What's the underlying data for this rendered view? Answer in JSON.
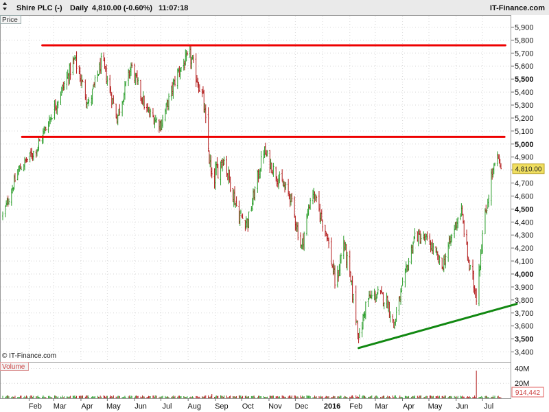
{
  "header": {
    "symbol": "Shire PLC (-)",
    "period": "Daily",
    "quote": "4,810.00 (-0.60%)",
    "time": "11:07:18",
    "brand": "IT-Finance.com"
  },
  "price_panel": {
    "label": "Price",
    "watermark": "© IT-Finance.com",
    "last_price_tag": "4,810.00"
  },
  "volume_panel": {
    "label": "Volume",
    "last_volume_tag": "914,442"
  },
  "colors": {
    "up": "#2a9d2a",
    "down": "#b21a1a",
    "resistance": "#ee0000",
    "support": "#118811",
    "grid": "#d6d6d6"
  },
  "chart_data": [
    {
      "type": "candlestick",
      "title": "Shire PLC (-) Daily",
      "ylabel": "Price",
      "ylim": [
        3350,
        5950
      ],
      "y_ticks": [
        {
          "value": 3400,
          "label": "3,400",
          "bold": false
        },
        {
          "value": 3500,
          "label": "3,500",
          "bold": true
        },
        {
          "value": 3600,
          "label": "3,600",
          "bold": false
        },
        {
          "value": 3700,
          "label": "3,700",
          "bold": false
        },
        {
          "value": 3800,
          "label": "3,800",
          "bold": false
        },
        {
          "value": 3900,
          "label": "3,900",
          "bold": false
        },
        {
          "value": 4000,
          "label": "4,000",
          "bold": true
        },
        {
          "value": 4100,
          "label": "4,100",
          "bold": false
        },
        {
          "value": 4200,
          "label": "4,200",
          "bold": false
        },
        {
          "value": 4300,
          "label": "4,300",
          "bold": false
        },
        {
          "value": 4400,
          "label": "4,400",
          "bold": false
        },
        {
          "value": 4500,
          "label": "4,500",
          "bold": true
        },
        {
          "value": 4600,
          "label": "4,600",
          "bold": false
        },
        {
          "value": 4700,
          "label": "4,700",
          "bold": false
        },
        {
          "value": 4800,
          "label": "4,800",
          "bold": false
        },
        {
          "value": 4900,
          "label": "4,900",
          "bold": false
        },
        {
          "value": 5000,
          "label": "5,000",
          "bold": true
        },
        {
          "value": 5100,
          "label": "5,100",
          "bold": false
        },
        {
          "value": 5200,
          "label": "5,200",
          "bold": false
        },
        {
          "value": 5300,
          "label": "5,300",
          "bold": false
        },
        {
          "value": 5400,
          "label": "5,400",
          "bold": false
        },
        {
          "value": 5500,
          "label": "5,500",
          "bold": true
        },
        {
          "value": 5600,
          "label": "5,600",
          "bold": false
        },
        {
          "value": 5700,
          "label": "5,700",
          "bold": false
        },
        {
          "value": 5800,
          "label": "5,800",
          "bold": false
        },
        {
          "value": 5900,
          "label": "5,900",
          "bold": false
        }
      ],
      "x_axis": {
        "start": "2015-01-02",
        "end": "2016-07-22",
        "labels": [
          {
            "label": "Feb",
            "date": "2015-02-01",
            "bold": false
          },
          {
            "label": "Mar",
            "date": "2015-03-01",
            "bold": false
          },
          {
            "label": "Apr",
            "date": "2015-04-01",
            "bold": false
          },
          {
            "label": "May",
            "date": "2015-05-01",
            "bold": false
          },
          {
            "label": "Jun",
            "date": "2015-06-01",
            "bold": false
          },
          {
            "label": "Jul",
            "date": "2015-07-01",
            "bold": false
          },
          {
            "label": "Aug",
            "date": "2015-08-01",
            "bold": false
          },
          {
            "label": "Sep",
            "date": "2015-09-01",
            "bold": false
          },
          {
            "label": "Oct",
            "date": "2015-10-01",
            "bold": false
          },
          {
            "label": "Nov",
            "date": "2015-11-01",
            "bold": false
          },
          {
            "label": "Dec",
            "date": "2015-12-01",
            "bold": false
          },
          {
            "label": "2016",
            "date": "2016-01-01",
            "bold": true
          },
          {
            "label": "Feb",
            "date": "2016-02-01",
            "bold": false
          },
          {
            "label": "Mar",
            "date": "2016-03-01",
            "bold": false
          },
          {
            "label": "Apr",
            "date": "2016-04-01",
            "bold": false
          },
          {
            "label": "May",
            "date": "2016-05-01",
            "bold": false
          },
          {
            "label": "Jun",
            "date": "2016-06-01",
            "bold": false
          },
          {
            "label": "Jul",
            "date": "2016-07-01",
            "bold": false
          }
        ]
      },
      "anchors": [
        {
          "date": "2015-01-02",
          "close": 4450,
          "range": 90
        },
        {
          "date": "2015-01-20",
          "close": 4800,
          "range": 100
        },
        {
          "date": "2015-02-10",
          "close": 4970,
          "range": 110
        },
        {
          "date": "2015-02-28",
          "close": 5250,
          "range": 120
        },
        {
          "date": "2015-03-25",
          "close": 5650,
          "range": 130
        },
        {
          "date": "2015-04-10",
          "close": 5300,
          "range": 130
        },
        {
          "date": "2015-04-25",
          "close": 5650,
          "range": 120
        },
        {
          "date": "2015-05-12",
          "close": 5200,
          "range": 120
        },
        {
          "date": "2015-05-28",
          "close": 5600,
          "range": 120
        },
        {
          "date": "2015-06-15",
          "close": 5250,
          "range": 120
        },
        {
          "date": "2015-07-01",
          "close": 5150,
          "range": 110
        },
        {
          "date": "2015-07-20",
          "close": 5550,
          "range": 120
        },
        {
          "date": "2015-08-03",
          "close": 5680,
          "range": 140
        },
        {
          "date": "2015-08-18",
          "close": 5350,
          "range": 150
        },
        {
          "date": "2015-08-28",
          "close": 4700,
          "range": 200
        },
        {
          "date": "2015-09-10",
          "close": 4900,
          "range": 150
        },
        {
          "date": "2015-09-28",
          "close": 4450,
          "range": 150
        },
        {
          "date": "2015-10-08",
          "close": 4400,
          "range": 140
        },
        {
          "date": "2015-10-26",
          "close": 4950,
          "range": 130
        },
        {
          "date": "2015-11-10",
          "close": 4750,
          "range": 120
        },
        {
          "date": "2015-11-25",
          "close": 4600,
          "range": 120
        },
        {
          "date": "2015-12-08",
          "close": 4200,
          "range": 130
        },
        {
          "date": "2015-12-20",
          "close": 4650,
          "range": 120
        },
        {
          "date": "2016-01-06",
          "close": 4300,
          "range": 130
        },
        {
          "date": "2016-01-16",
          "close": 3900,
          "range": 150
        },
        {
          "date": "2016-01-25",
          "close": 4250,
          "range": 150
        },
        {
          "date": "2016-02-04",
          "close": 3850,
          "range": 150
        },
        {
          "date": "2016-02-12",
          "close": 3500,
          "range": 150
        },
        {
          "date": "2016-02-20",
          "close": 3800,
          "range": 130
        },
        {
          "date": "2016-03-05",
          "close": 3850,
          "range": 110
        },
        {
          "date": "2016-03-15",
          "close": 3780,
          "range": 120
        },
        {
          "date": "2016-03-22",
          "close": 3600,
          "range": 150
        },
        {
          "date": "2016-04-01",
          "close": 3900,
          "range": 120
        },
        {
          "date": "2016-04-15",
          "close": 4300,
          "range": 110
        },
        {
          "date": "2016-05-01",
          "close": 4250,
          "range": 110
        },
        {
          "date": "2016-05-16",
          "close": 4050,
          "range": 110
        },
        {
          "date": "2016-06-01",
          "close": 4400,
          "range": 120
        },
        {
          "date": "2016-06-07",
          "close": 4480,
          "range": 110
        },
        {
          "date": "2016-06-16",
          "close": 4050,
          "range": 120
        },
        {
          "date": "2016-06-24",
          "close": 3850,
          "range": 200
        },
        {
          "date": "2016-07-01",
          "close": 4300,
          "range": 140
        },
        {
          "date": "2016-07-11",
          "close": 4750,
          "range": 120
        },
        {
          "date": "2016-07-18",
          "close": 4900,
          "range": 90
        },
        {
          "date": "2016-07-22",
          "close": 4810,
          "range": 80
        }
      ],
      "last_close": 4810,
      "trendlines": [
        {
          "name": "resistance-upper",
          "color": "#ee0000",
          "from": {
            "date": "2015-02-16",
            "value": 5760
          },
          "to": {
            "date": "2016-07-27",
            "value": 5760
          }
        },
        {
          "name": "resistance-lower",
          "color": "#ee0000",
          "from": {
            "date": "2015-01-24",
            "value": 5055
          },
          "to": {
            "date": "2016-07-26",
            "value": 5055
          }
        },
        {
          "name": "support-rising",
          "color": "#118811",
          "from": {
            "date": "2016-02-11",
            "value": 3430
          },
          "to": {
            "date": "2016-08-09",
            "value": 3770
          }
        }
      ]
    },
    {
      "type": "bar",
      "title": "Volume",
      "ylim": [
        0,
        45000000
      ],
      "y_ticks": [
        {
          "value": 20000000,
          "label": "20M"
        },
        {
          "value": 40000000,
          "label": "40M"
        }
      ],
      "baseline_volume": 2500000,
      "spikes": [
        {
          "date": "2016-06-24",
          "value": 37000000
        },
        {
          "date": "2015-08-28",
          "value": 5500000
        },
        {
          "date": "2016-02-12",
          "value": 5000000
        }
      ],
      "last_value": 914442
    }
  ]
}
